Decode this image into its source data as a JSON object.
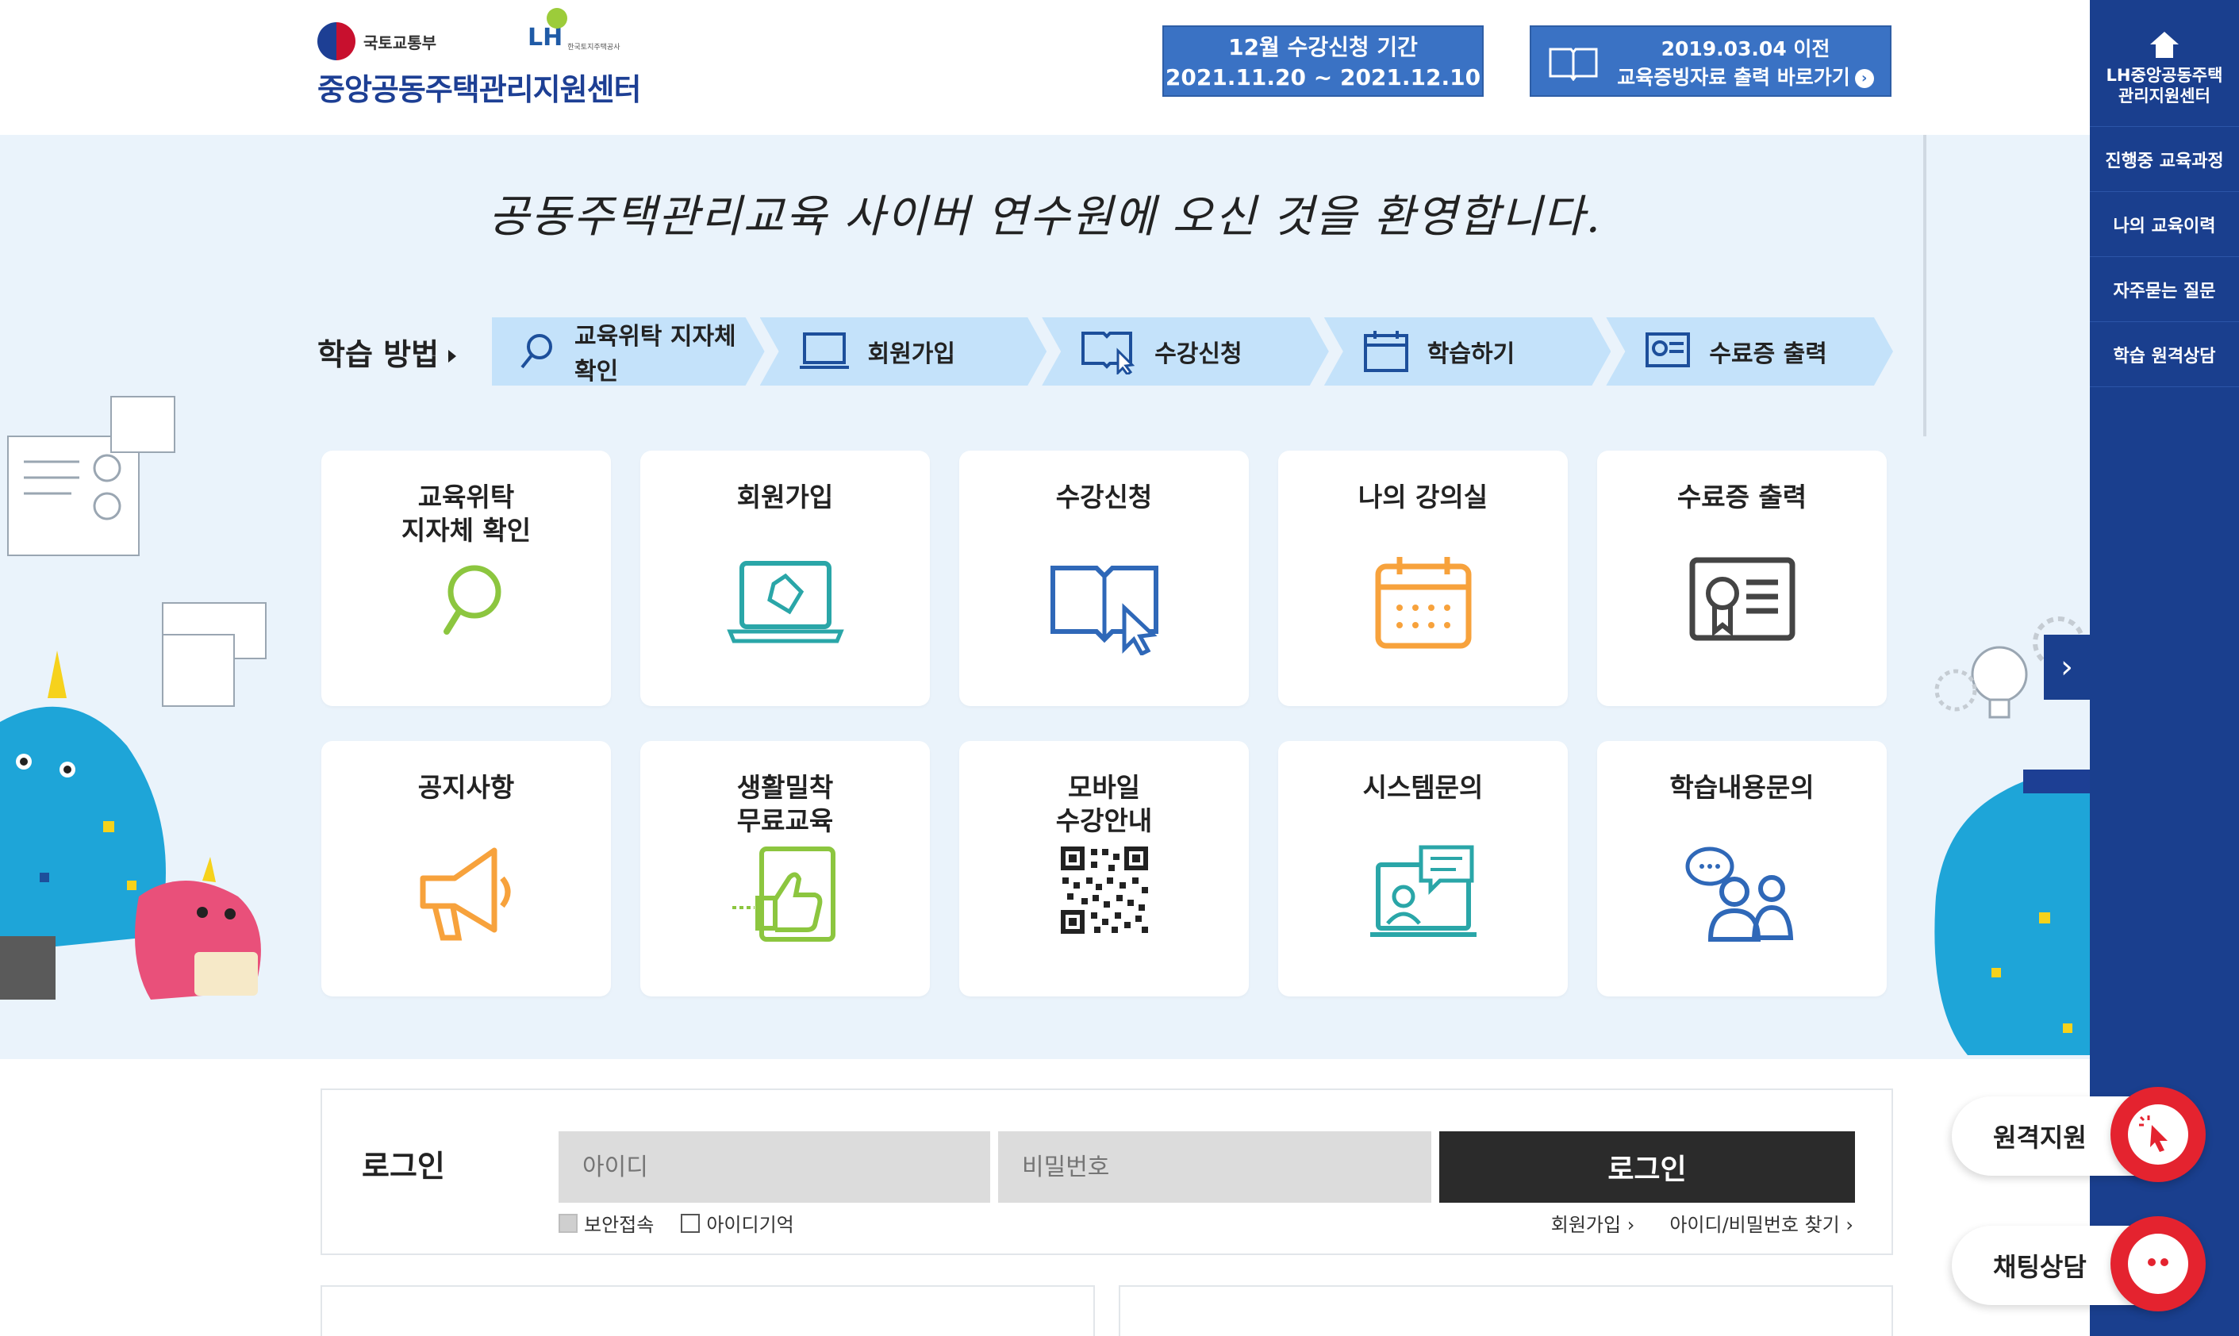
{
  "header": {
    "ministry": "국토교통부",
    "lh_mark": "LH",
    "lh_sub": "한국토지주택공사",
    "center_name": "중앙공동주택관리지원센터",
    "period_title": "12월 수강신청 기간",
    "period_range": "2021.11.20 ~ 2021.12.10",
    "print_line1": "2019.03.04 이전",
    "print_line2": "교육증빙자료 출력 바로가기"
  },
  "sidebar": {
    "home_line1": "LH중앙공동주택",
    "home_line2": "관리지원센터",
    "items": [
      {
        "label": "진행중 교육과정"
      },
      {
        "label": "나의 교육이력"
      },
      {
        "label": "자주묻는 질문"
      },
      {
        "label": "학습 원격상담"
      }
    ]
  },
  "main": {
    "welcome": "공동주택관리교육 사이버 연수원에 오신 것을 환영합니다."
  },
  "steps": {
    "label": "학습 방법",
    "items": [
      {
        "label": "교육위탁 지자체 확인",
        "icon": "search-icon"
      },
      {
        "label": "회원가입",
        "icon": "laptop-icon"
      },
      {
        "label": "수강신청",
        "icon": "book-cursor-icon"
      },
      {
        "label": "학습하기",
        "icon": "calendar-icon"
      },
      {
        "label": "수료증 출력",
        "icon": "certificate-icon"
      }
    ]
  },
  "cards": [
    {
      "title": "교육위탁\n지자체 확인",
      "icon": "search-icon",
      "color": "#8cc63f"
    },
    {
      "title": "회원가입",
      "icon": "laptop-icon",
      "color": "#2aa6a8"
    },
    {
      "title": "수강신청",
      "icon": "book-cursor-icon",
      "color": "#2f68b8"
    },
    {
      "title": "나의 강의실",
      "icon": "calendar-icon",
      "color": "#f7a23c"
    },
    {
      "title": "수료증 출력",
      "icon": "certificate-icon",
      "color": "#444444"
    },
    {
      "title": "공지사항",
      "icon": "megaphone-icon",
      "color": "#f7a23c"
    },
    {
      "title": "생활밀착\n무료교육",
      "icon": "thumbs-up-icon",
      "color": "#8cc63f"
    },
    {
      "title": "모바일\n수강안내",
      "icon": "qr-code-icon",
      "color": "#222222"
    },
    {
      "title": "시스템문의",
      "icon": "video-chat-icon",
      "color": "#2aa6a8"
    },
    {
      "title": "학습내용문의",
      "icon": "consult-icon",
      "color": "#2f68b8"
    }
  ],
  "login": {
    "title": "로그인",
    "id_placeholder": "아이디",
    "pw_placeholder": "비밀번호",
    "button": "로그인",
    "secure_label": "보안접속",
    "remember_label": "아이디기억",
    "signup_link": "회원가입",
    "find_link": "아이디/비밀번호 찾기"
  },
  "floating": {
    "remote_label": "원격지원",
    "chat_label": "채팅상담"
  },
  "colors": {
    "primary": "#1a3f8e",
    "accent_blue": "#3a72c4",
    "band_bg": "#eaf3fb",
    "step_bg": "#c4e2fa",
    "support_red": "#e4232f"
  }
}
